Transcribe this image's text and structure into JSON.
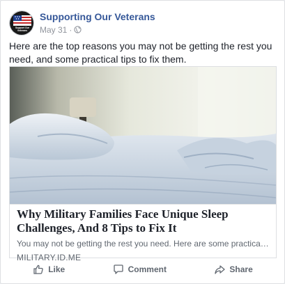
{
  "post": {
    "page_name": "Supporting Our Veterans",
    "date": "May 31",
    "separator": "·",
    "privacy_icon": "globe-icon",
    "text": "Here are the top reasons you may not be getting the rest you need, and some practical tips to fix them."
  },
  "avatar": {
    "logo_text": "Support Our Veterans"
  },
  "link": {
    "title": "Why Military Families Face Unique Sleep Challenges, And 8 Tips to Fix It",
    "description": "You may not be getting the rest you need. Here are some practical tips for...",
    "domain": "MILITARY.ID.ME"
  },
  "actions": {
    "like_label": "Like",
    "comment_label": "Comment",
    "share_label": "Share"
  },
  "colors": {
    "page_name": "#365899",
    "action_text": "#606770",
    "meta_text": "#90949c"
  }
}
